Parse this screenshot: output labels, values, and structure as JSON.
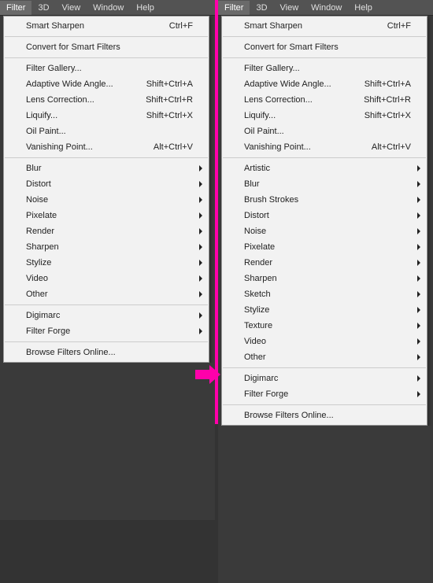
{
  "menubar": [
    "Filter",
    "3D",
    "View",
    "Window",
    "Help"
  ],
  "left": {
    "groups": [
      [
        {
          "label": "Smart Sharpen",
          "shortcut": "Ctrl+F"
        }
      ],
      [
        {
          "label": "Convert for Smart Filters"
        }
      ],
      [
        {
          "label": "Filter Gallery..."
        },
        {
          "label": "Adaptive Wide Angle...",
          "shortcut": "Shift+Ctrl+A"
        },
        {
          "label": "Lens Correction...",
          "shortcut": "Shift+Ctrl+R"
        },
        {
          "label": "Liquify...",
          "shortcut": "Shift+Ctrl+X"
        },
        {
          "label": "Oil Paint..."
        },
        {
          "label": "Vanishing Point...",
          "shortcut": "Alt+Ctrl+V"
        }
      ],
      [
        {
          "label": "Blur",
          "sub": true
        },
        {
          "label": "Distort",
          "sub": true
        },
        {
          "label": "Noise",
          "sub": true
        },
        {
          "label": "Pixelate",
          "sub": true
        },
        {
          "label": "Render",
          "sub": true
        },
        {
          "label": "Sharpen",
          "sub": true
        },
        {
          "label": "Stylize",
          "sub": true
        },
        {
          "label": "Video",
          "sub": true
        },
        {
          "label": "Other",
          "sub": true
        }
      ],
      [
        {
          "label": "Digimarc",
          "sub": true
        },
        {
          "label": "Filter Forge",
          "sub": true
        }
      ],
      [
        {
          "label": "Browse Filters Online..."
        }
      ]
    ]
  },
  "right": {
    "groups": [
      [
        {
          "label": "Smart Sharpen",
          "shortcut": "Ctrl+F"
        }
      ],
      [
        {
          "label": "Convert for Smart Filters"
        }
      ],
      [
        {
          "label": "Filter Gallery..."
        },
        {
          "label": "Adaptive Wide Angle...",
          "shortcut": "Shift+Ctrl+A"
        },
        {
          "label": "Lens Correction...",
          "shortcut": "Shift+Ctrl+R"
        },
        {
          "label": "Liquify...",
          "shortcut": "Shift+Ctrl+X"
        },
        {
          "label": "Oil Paint..."
        },
        {
          "label": "Vanishing Point...",
          "shortcut": "Alt+Ctrl+V"
        }
      ],
      [
        {
          "label": "Artistic",
          "sub": true
        },
        {
          "label": "Blur",
          "sub": true
        },
        {
          "label": "Brush Strokes",
          "sub": true
        },
        {
          "label": "Distort",
          "sub": true
        },
        {
          "label": "Noise",
          "sub": true
        },
        {
          "label": "Pixelate",
          "sub": true
        },
        {
          "label": "Render",
          "sub": true
        },
        {
          "label": "Sharpen",
          "sub": true
        },
        {
          "label": "Sketch",
          "sub": true
        },
        {
          "label": "Stylize",
          "sub": true
        },
        {
          "label": "Texture",
          "sub": true
        },
        {
          "label": "Video",
          "sub": true
        },
        {
          "label": "Other",
          "sub": true
        }
      ],
      [
        {
          "label": "Digimarc",
          "sub": true
        },
        {
          "label": "Filter Forge",
          "sub": true
        }
      ],
      [
        {
          "label": "Browse Filters Online..."
        }
      ]
    ]
  }
}
